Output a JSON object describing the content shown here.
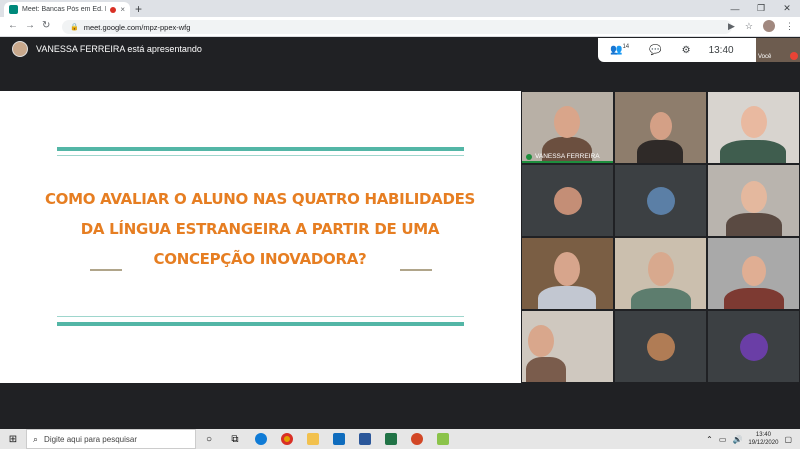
{
  "browser": {
    "tab_title": "Meet: Bancas Pós em Ed. In",
    "tab_close": "×",
    "new_tab": "+",
    "url": "meet.google.com/mpz-ppex-wfg",
    "window_controls": [
      "—",
      "❐",
      "✕"
    ],
    "nav": {
      "back": "←",
      "forward": "→",
      "reload": "↻"
    }
  },
  "meet": {
    "presenter_text": "VANESSA FERREIRA está apresentando",
    "participants_count": "14",
    "time": "13:40",
    "self_label": "Você",
    "icons": [
      "people-icon",
      "chat-icon",
      "activities-icon"
    ]
  },
  "slide": {
    "line1": "COMO AVALIAR O ALUNO NAS QUATRO HABILIDADES",
    "line2": "DA LÍNGUA ESTRANGEIRA A PARTIR DE UMA",
    "line3": "CONCEPÇÃO INOVADORA?",
    "accent_color": "#e67e22",
    "rule_color": "#53b6a6"
  },
  "participants": [
    {
      "name": "VANESSA FERREIRA",
      "speaking": true
    },
    {
      "name": ""
    },
    {
      "name": ""
    },
    {
      "name": ""
    },
    {
      "name": ""
    },
    {
      "name": ""
    },
    {
      "name": ""
    },
    {
      "name": ""
    },
    {
      "name": ""
    },
    {
      "name": ""
    },
    {
      "name": ""
    },
    {
      "name": ""
    }
  ],
  "taskbar": {
    "search_placeholder": "Digite aqui para pesquisar",
    "time": "13:40",
    "date": "19/12/2020"
  }
}
